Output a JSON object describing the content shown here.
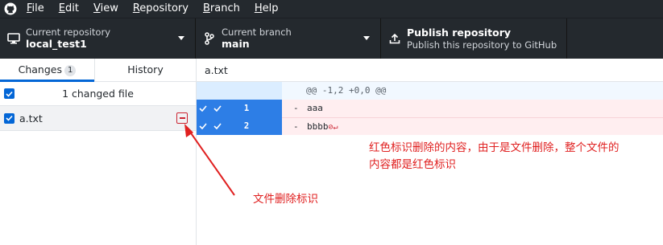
{
  "menubar": {
    "items": [
      {
        "key": "F",
        "rest": "ile"
      },
      {
        "key": "E",
        "rest": "dit"
      },
      {
        "key": "V",
        "rest": "iew"
      },
      {
        "key": "R",
        "rest": "epository"
      },
      {
        "key": "B",
        "rest": "ranch"
      },
      {
        "key": "H",
        "rest": "elp"
      }
    ]
  },
  "toolbar": {
    "repo": {
      "label": "Current repository",
      "value": "local_test1"
    },
    "branch": {
      "label": "Current branch",
      "value": "main"
    },
    "publish": {
      "title": "Publish repository",
      "subtitle": "Publish this repository to GitHub"
    }
  },
  "sidebar": {
    "tabs": {
      "changes": "Changes",
      "changes_count": "1",
      "history": "History"
    },
    "summary": "1 changed file",
    "file": {
      "name": "a.txt",
      "status": "deleted"
    }
  },
  "diff": {
    "file": "a.txt",
    "hunk_header": "@@ -1,2 +0,0 @@",
    "lines": [
      {
        "num": "1",
        "marker": "-",
        "text": "aaa"
      },
      {
        "num": "2",
        "marker": "-",
        "text": "bbbb"
      }
    ]
  },
  "annotations": {
    "main_line1": "红色标识删除的内容，由于是文件删除，整个文件的",
    "main_line2": "内容都是红色标识",
    "file_label": "文件删除标识",
    "color": "#e02020"
  },
  "colors": {
    "toolbar_bg": "#24292e",
    "accent": "#0366d6",
    "deleted": "#cb2431",
    "deleted_bg": "#ffeef0"
  }
}
